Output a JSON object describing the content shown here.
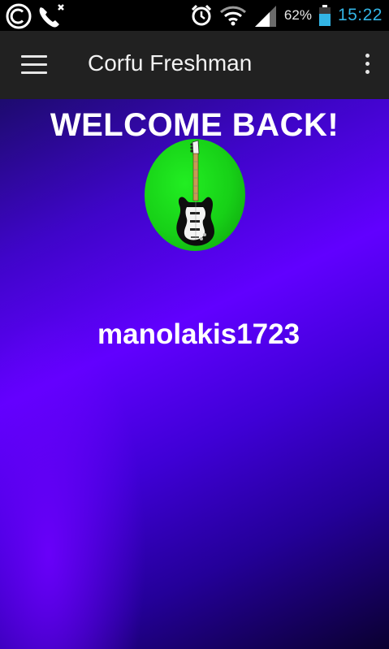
{
  "status_bar": {
    "battery_percent": "62%",
    "time": "15:22",
    "icons": [
      "carrier-c-icon",
      "phone-missed-icon",
      "alarm-icon",
      "wifi-icon",
      "signal-icon",
      "battery-icon"
    ],
    "time_color": "#33b5e5"
  },
  "action_bar": {
    "title": "Corfu Freshman",
    "icons": [
      "menu-icon",
      "overflow-menu-icon"
    ],
    "background": "#212121"
  },
  "main": {
    "welcome_text": "WELCOME BACK!",
    "avatar_icon": "electric-guitar-icon",
    "username": "manolakis1723",
    "accent_color": "#6100ff"
  }
}
